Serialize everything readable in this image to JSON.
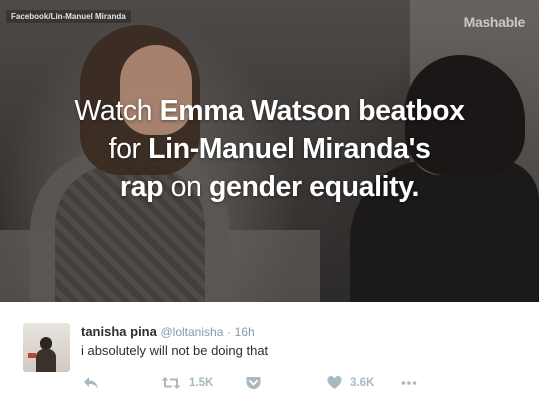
{
  "media": {
    "source_label": "Facebook/Lin-Manuel Miranda",
    "brand": "Mashable",
    "headline": {
      "line1_a": "Watch ",
      "line1_b": "Emma Watson beatbox",
      "line2_a": "for ",
      "line2_b": "Lin-Manuel Miranda's",
      "line3_a": "rap",
      "line3_b": " on ",
      "line3_c": "gender equality."
    }
  },
  "tweet": {
    "name": "tanisha pina",
    "handle": "@loltanisha",
    "separator": "·",
    "time": "16h",
    "text": "i absolutely will not be doing that",
    "actions": {
      "reply_icon": "reply-icon",
      "retweet_icon": "retweet-icon",
      "retweet_count": "1.5K",
      "save_icon": "pocket-icon",
      "like_icon": "heart-icon",
      "like_count": "3.6K",
      "more_icon": "more-icon"
    }
  },
  "colors": {
    "text_primary": "#292f33",
    "text_secondary": "#8899a6",
    "action_icon": "#aab8c2"
  }
}
